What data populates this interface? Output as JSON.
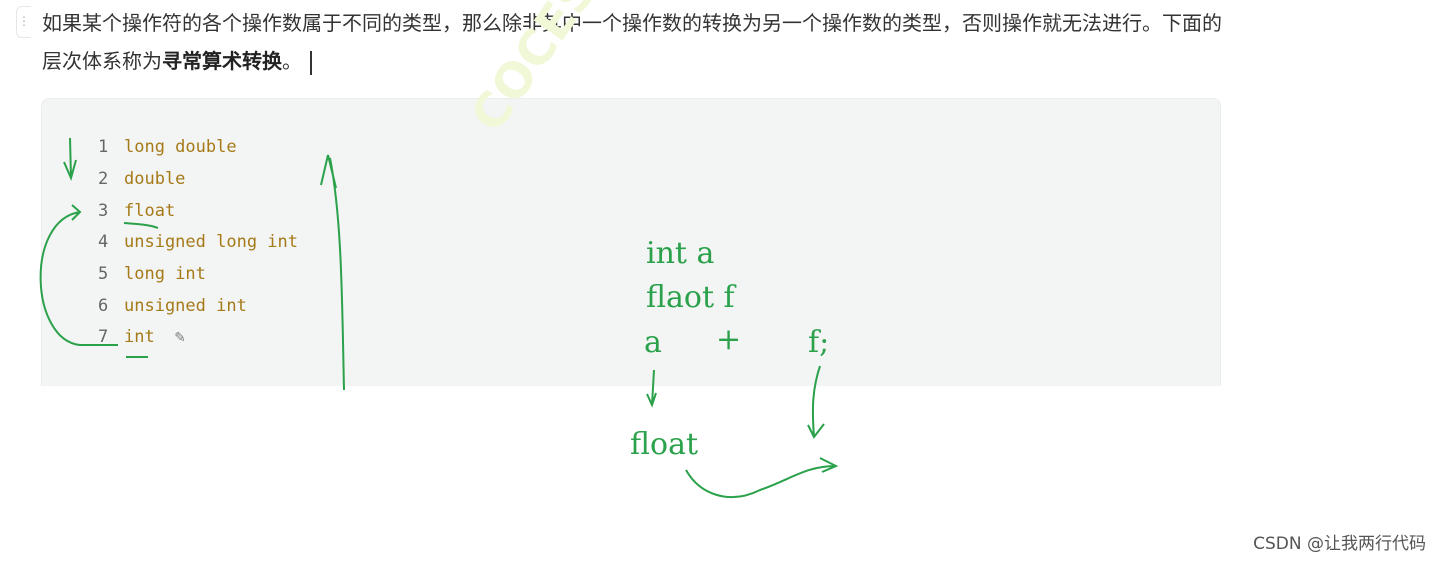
{
  "paragraph": {
    "text": "如果某个操作符的各个操作数属于不同的类型，那么除非其中一个操作数的转换为另一个操作数的类型，否则操作就无法进行。下面的层次体系称为",
    "bold": "寻常算术转换",
    "end": "。"
  },
  "code_lines": [
    {
      "num": "1",
      "text": "long double"
    },
    {
      "num": "2",
      "text": "double"
    },
    {
      "num": "3",
      "text": "float"
    },
    {
      "num": "4",
      "text": "unsigned long int"
    },
    {
      "num": "5",
      "text": "long int"
    },
    {
      "num": "6",
      "text": "unsigned int"
    },
    {
      "num": "7",
      "text": "int"
    }
  ],
  "handwriting": {
    "line1": "int a",
    "line2": "flaot f",
    "a": "a",
    "plus": "+",
    "f": "f;",
    "result": "float"
  },
  "watermark": "COCESOIRC",
  "footer": "CSDN @让我两行代码",
  "colors": {
    "keyword": "#a67a18",
    "ink": "#2aa14a"
  }
}
